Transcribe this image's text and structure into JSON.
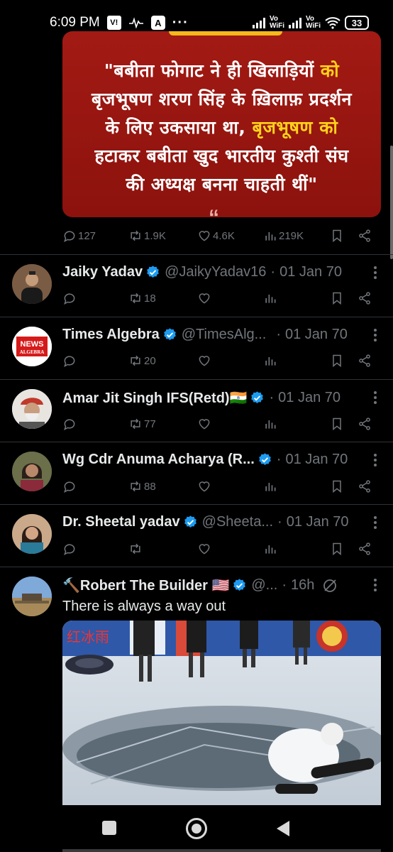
{
  "status_bar": {
    "time": "6:09 PM",
    "notif_badge": "V!",
    "nav_icon": "A",
    "more_dots": "···",
    "vowifi_1": "Vo\nWiFi",
    "vowifi_2": "Vo\nWiFi",
    "battery": "33"
  },
  "first_tweet": {
    "image_lines": [
      {
        "w": "\"बबीता फोगाट ने ही खिलाड़ियों ",
        "y": "को"
      },
      {
        "w": "बृजभूषण शरण सिंह के ख़िलाफ़ प्रदर्शन",
        "y": ""
      },
      {
        "w": "के लिए उकसाया था, ",
        "y": "बृजभूषण को"
      },
      {
        "w": "हटाकर बबीता खुद भारतीय कुश्ती संघ",
        "y": ""
      },
      {
        "w": "की अध्यक्ष बनना चाहती थीं\"",
        "y": ""
      }
    ],
    "image_quote_mark": "“",
    "replies": "127",
    "retweets": "1.9K",
    "likes": "4.6K",
    "views": "219K"
  },
  "tweets": [
    {
      "name": "Jaiky Yadav",
      "handle": "@JaikyYadav16",
      "sep": "·",
      "date": "01 Jan 70",
      "retweets": "18",
      "likes": "",
      "views": ""
    },
    {
      "name": "Times Algebra",
      "handle": "@TimesAlg...",
      "sep": "·",
      "date": "01 Jan 70",
      "retweets": "20",
      "likes": "",
      "views": "",
      "avatar_text_1": "NEWS",
      "avatar_text_2": "ALGEBRA"
    },
    {
      "name": "Amar Jit Singh IFS(Retd)🇮🇳",
      "handle": "",
      "sep": "·",
      "date": "01 Jan 70",
      "retweets": "77",
      "likes": "",
      "views": ""
    },
    {
      "name": "Wg Cdr Anuma Acharya (R...",
      "handle": "",
      "sep": "·",
      "date": "01 Jan 70",
      "retweets": "88",
      "likes": "",
      "views": ""
    },
    {
      "name": "Dr. Sheetal yadav",
      "handle": "@Sheeta...",
      "sep": "·",
      "date": "01 Jan 70",
      "retweets": "",
      "likes": "",
      "views": ""
    }
  ],
  "last_tweet": {
    "name": "🔨Robert The Builder 🇺🇸",
    "handle": "@...",
    "sep": "·",
    "time": "16h",
    "text": "There is always a way out",
    "video_banner_text": "红冰雨"
  },
  "colors": {
    "background": "#000000",
    "text": "#e7e9ea",
    "muted": "#71767b",
    "verified": "#1d9bf0",
    "divider": "#2f3336"
  }
}
